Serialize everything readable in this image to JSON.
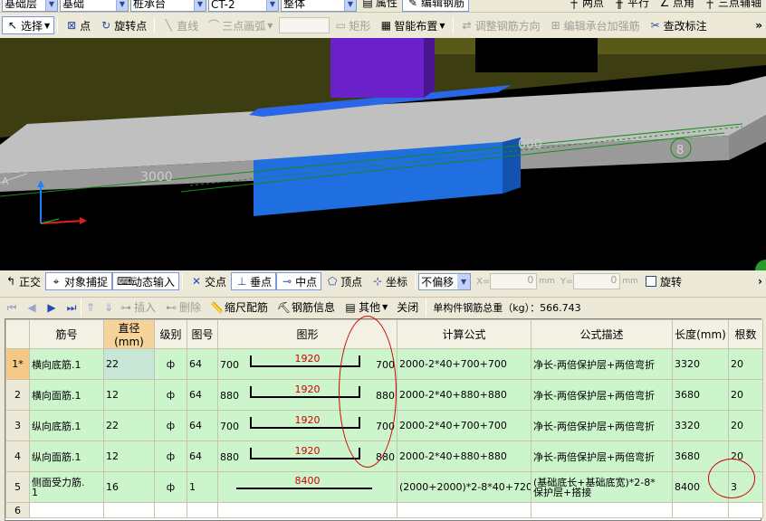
{
  "topbar": {
    "floor": "基础层",
    "category": "基础",
    "component_type": "桩承台",
    "component": "CT-2",
    "scope": "整体",
    "attr_btn": "属性",
    "edit_rebar_btn": "编辑钢筋",
    "r1": "两点",
    "r2": "平行",
    "r3": "点角",
    "r4": "三点辅轴"
  },
  "toolbar1": {
    "select": "选择",
    "point": "点",
    "rotate_point": "旋转点",
    "line": "直线",
    "arc": "三点画弧",
    "rect": "矩形",
    "smart": "智能布置",
    "adjust_dir": "调整钢筋方向",
    "edit_cap": "编辑承台加强筋",
    "check_mark": "查改标注"
  },
  "viewport": {
    "dim1": "3000",
    "dim2": "000",
    "axis": "8",
    "axis_a": "A",
    "colors": {
      "bg": "#000000",
      "slab": "#b4b4b4",
      "purple": "#6a1fc4",
      "blue": "#1a5fd6",
      "olive": "#4a4a10"
    }
  },
  "toolbar2": {
    "ortho": "正交",
    "snap": "对象捕捉",
    "dyn": "动态输入",
    "inter": "交点",
    "perp": "垂点",
    "mid": "中点",
    "vertex": "顶点",
    "coord": "坐标",
    "offset": "不偏移",
    "x_label": "X=",
    "x_val": "0",
    "y_label": "Y=",
    "y_val": "0",
    "unit": "mm",
    "rotate": "旋转"
  },
  "toolbar3": {
    "insert": "插入",
    "delete": "删除",
    "scale": "缩尺配筋",
    "info": "钢筋信息",
    "other": "其他",
    "close": "关闭",
    "total": "单构件钢筋总重（kg）：566.743"
  },
  "grid": {
    "headers": [
      "",
      "筋号",
      "直径(mm)",
      "级别",
      "图号",
      "图形",
      "计算公式",
      "公式描述",
      "长度(mm)",
      "根数"
    ],
    "rows": [
      {
        "n": "1*",
        "name": "横向底筋.1",
        "dia": "22",
        "grade": "ф",
        "fig": "64",
        "left": "700",
        "mid": "1920",
        "right": "700",
        "formula": "2000-2*40+700+700",
        "desc": "净长-两倍保护层+两倍弯折",
        "len": "3320",
        "count": "20"
      },
      {
        "n": "2",
        "name": "横向面筋.1",
        "dia": "12",
        "grade": "ф",
        "fig": "64",
        "left": "880",
        "mid": "1920",
        "right": "880",
        "formula": "2000-2*40+880+880",
        "desc": "净长-两倍保护层+两倍弯折",
        "len": "3680",
        "count": "20"
      },
      {
        "n": "3",
        "name": "纵向底筋.1",
        "dia": "22",
        "grade": "ф",
        "fig": "64",
        "left": "700",
        "mid": "1920",
        "right": "700",
        "formula": "2000-2*40+700+700",
        "desc": "净长-两倍保护层+两倍弯折",
        "len": "3320",
        "count": "20"
      },
      {
        "n": "4",
        "name": "纵向面筋.1",
        "dia": "12",
        "grade": "ф",
        "fig": "64",
        "left": "880",
        "mid": "1920",
        "right": "880",
        "formula": "2000-2*40+880+880",
        "desc": "净长-两倍保护层+两倍弯折",
        "len": "3680",
        "count": "20"
      },
      {
        "n": "5",
        "name": "侧面受力筋.",
        "name2": "1",
        "dia": "16",
        "grade": "ф",
        "fig": "1",
        "left": "",
        "mid": "8400",
        "right": "",
        "formula": "(2000+2000)*2-8*40+720",
        "desc": "(基础底长+基础底宽)*2-8*",
        "desc2": "保护层+搭接",
        "len": "8400",
        "count": "3"
      },
      {
        "n": "6"
      }
    ]
  }
}
